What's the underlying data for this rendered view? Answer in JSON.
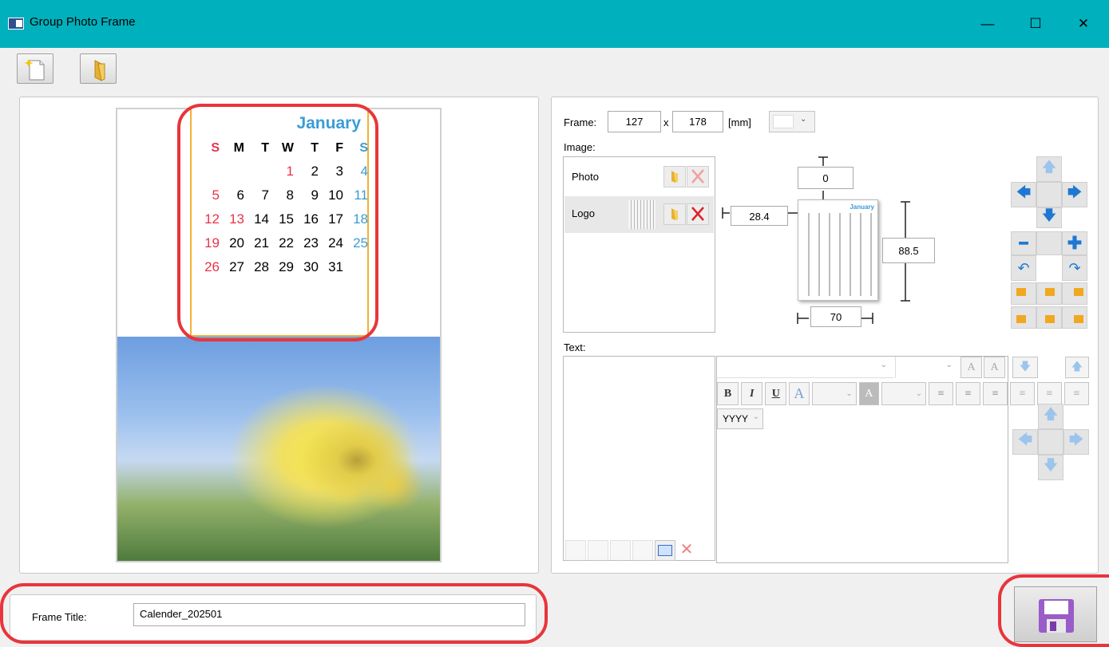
{
  "window": {
    "title": "Group Photo Frame",
    "minimize": "—",
    "maximize": "☐",
    "close": "✕"
  },
  "calendar": {
    "month": "January",
    "weekdays": [
      "S",
      "M",
      "T",
      "W",
      "T",
      "F",
      "S"
    ],
    "rows": [
      [
        "",
        "",
        "",
        "1",
        "2",
        "3",
        "4"
      ],
      [
        "5",
        "6",
        "7",
        "8",
        "9",
        "10",
        "11"
      ],
      [
        "12",
        "13",
        "14",
        "15",
        "16",
        "17",
        "18"
      ],
      [
        "19",
        "20",
        "21",
        "22",
        "23",
        "24",
        "25"
      ],
      [
        "26",
        "27",
        "28",
        "29",
        "30",
        "31",
        ""
      ]
    ],
    "colors": {
      "sunday": "#e8334a",
      "saturday": "#3a9cd6",
      "holiday": "#e8334a",
      "border": "#f2b134"
    }
  },
  "frame": {
    "label": "Frame:",
    "width": "127",
    "x": "x",
    "height": "178",
    "unit": "[mm]"
  },
  "image": {
    "label": "Image:",
    "items": [
      {
        "name": "Photo"
      },
      {
        "name": "Logo"
      }
    ],
    "offset_top": "0",
    "offset_left": "28.4",
    "height_value": "88.5",
    "width_value": "70",
    "thumb_month": "January"
  },
  "text": {
    "label": "Text:",
    "date_format": "YYYY"
  },
  "bottom": {
    "frame_title_label": "Frame Title:",
    "frame_title_value": "Calender_202501"
  },
  "colors": {
    "titlebar": "#00b0bd",
    "arrow": "#1e78d2",
    "highlight": "#e8353b"
  }
}
